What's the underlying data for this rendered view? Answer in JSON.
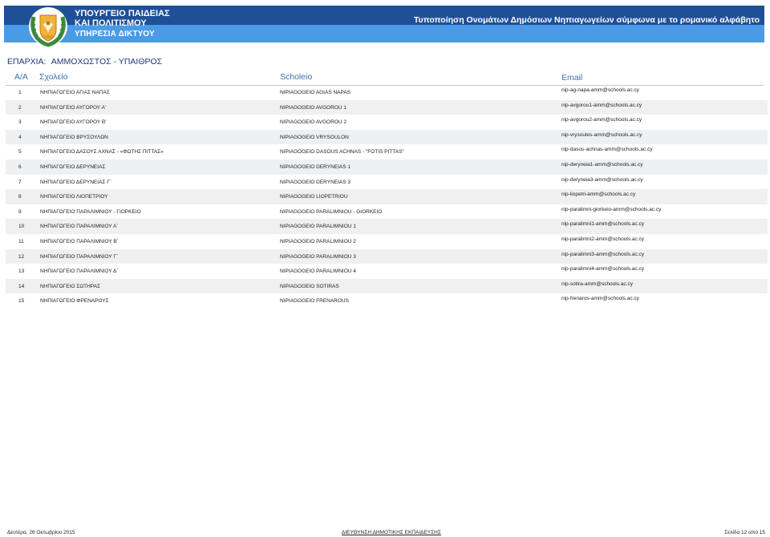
{
  "header": {
    "ministry_line1": "ΥΠΟΥΡΓΕΙΟ ΠΑΙΔΕΙΑΣ",
    "ministry_line2": "ΚΑΙ ΠΟΛΙΤΙΣΜΟΥ",
    "service": "ΥΠΗΡΕΣΙΑ ΔΙΚΤΥΟΥ",
    "tagline": "Τυποποίηση Ονομάτων Δημόσιων Νηπιαγωγείων σύμφωνα με το ρομανικό αλφάβητο",
    "colors": {
      "banner_dark": "#1f4f96",
      "banner_light": "#4b9ae6"
    },
    "logo_icon": "cyprus-coat-of-arms-icon"
  },
  "district": {
    "label": "ΕΠΑΡΧΙΑ:",
    "value": "ΑΜΜΟΧΩΣΤΟΣ - ΥΠΑΙΘΡΟΣ"
  },
  "table": {
    "columns": [
      "Α/Α",
      "Σχολείο",
      "Scholeio",
      "Email"
    ],
    "rows": [
      {
        "num": "1",
        "school": "ΝΗΠΙΑΓΩΓΕΙΟ ΑΓΙΑΣ ΝΑΠΑΣ",
        "scholeio": "NIPIAGOGEIO AGIAS NAPAS",
        "email": "nip-ag-napa-amm@schools.ac.cy"
      },
      {
        "num": "2",
        "school": "ΝΗΠΙΑΓΩΓΕΙΟ ΑΥΓΟΡΟΥ Α'",
        "scholeio": "NIPIAGOGEIO AVGOROU 1",
        "email": "nip-avgorou1-amm@schools.ac.cy"
      },
      {
        "num": "3",
        "school": "ΝΗΠΙΑΓΩΓΕΙΟ ΑΥΓΟΡΟΥ Β'",
        "scholeio": "NIPIAGOGEIO AVGOROU 2",
        "email": "nip-avgorou2-amm@schools.ac.cy"
      },
      {
        "num": "4",
        "school": "ΝΗΠΙΑΓΩΓΕΙΟ ΒΡΥΣΟΥΛΩΝ",
        "scholeio": "NIPIAGOGEIO VRYSOULON",
        "email": "nip-vrysoules-amm@schools.ac.cy"
      },
      {
        "num": "5",
        "school": "ΝΗΠΙΑΓΩΓΕΙΟ ΔΑΣΟΥΣ ΑΧΝΑΣ - «ΦΩΤΗΣ ΠΙΤΤΑΣ»",
        "scholeio": "NIPIAGOGEIO DASOUS ACHNAS - \"FOTIS PITTAS\"",
        "email": "nip-dasos-achnas-amm@schools.ac.cy"
      },
      {
        "num": "6",
        "school": "ΝΗΠΙΑΓΩΓΕΙΟ ΔΕΡΥΝΕΙΑΣ",
        "scholeio": "NIPIAGOGEIO DERYNEIAS 1",
        "email": "nip-deryneia1-amm@schools.ac.cy"
      },
      {
        "num": "7",
        "school": "ΝΗΠΙΑΓΩΓΕΙΟ ΔΕΡΥΝΕΙΑΣ Γ΄",
        "scholeio": "NIPIAGOGEIO DERYNEIAS 3",
        "email": "nip-deryneia3-amm@schools.ac.cy"
      },
      {
        "num": "8",
        "school": "ΝΗΠΙΑΓΩΓΕΙΟ ΛΙΟΠΕΤΡΙΟΥ",
        "scholeio": "NIPIAGOGEIO LIOPETRIOU",
        "email": "nip-liopetri-amm@schools.ac.cy"
      },
      {
        "num": "9",
        "school": "ΝΗΠΙΑΓΩΓΕΙΟ ΠΑΡΑΛΙΜΝΙΟΥ - ΓΙΟΡΚΕΙΟ",
        "scholeio": "NIPIAGOGEIO PARALIMNIOU  - GIORKEIO",
        "email": "nip-paralimni-giorkeio-amm@schools.ac.cy"
      },
      {
        "num": "10",
        "school": "ΝΗΠΙΑΓΩΓΕΙΟ ΠΑΡΑΛΙΜΝΙΟΥ Α΄",
        "scholeio": "NIPIAGOGEIO PARALIMNIOU 1",
        "email": "nip-paralimni1-amm@schools.ac.cy"
      },
      {
        "num": "11",
        "school": "ΝΗΠΙΑΓΩΓΕΙΟ ΠΑΡΑΛΙΜΝΙΟΥ Β΄",
        "scholeio": "NIPIAGOGEIO PARALIMNIOU 2",
        "email": "nip-paralimni2-amm@schools.ac.cy"
      },
      {
        "num": "12",
        "school": "ΝΗΠΙΑΓΩΓΕΙΟ ΠΑΡΑΛΙΜΝΙΟΥ Γ΄",
        "scholeio": "NIPIAGOGEIO PARALIMNIOU 3",
        "email": "nip-paralimni3-amm@schools.ac.cy"
      },
      {
        "num": "13",
        "school": "ΝΗΠΙΑΓΩΓΕΙΟ ΠΑΡΑΛΙΜΝΙΟΥ Δ΄",
        "scholeio": "NIPIAGOGEIO PARALIMNIOU 4",
        "email": "nip-paralimni4-amm@schools.ac.cy"
      },
      {
        "num": "14",
        "school": "ΝΗΠΙΑΓΩΓΕΙΟ ΣΩΤΗΡΑΣ",
        "scholeio": "NIPIAGOGEIO SOTIRAS",
        "email": "nip-sotira-amm@schools.ac.cy"
      },
      {
        "num": "15",
        "school": "ΝΗΠΙΑΓΩΓΕΙΟ ΦΡΕΝΑΡΟΥΣ",
        "scholeio": "NIPIAGOGEIO FRENAROUS",
        "email": "nip-frenaros-amm@schools.ac.cy"
      }
    ]
  },
  "footer": {
    "date": "Δευτέρα, 26 Οκτωβρίου 2015",
    "department": "ΔΙΕΥΘΥΝΣΗ ΔΗΜΟΤΙΚΗΣ ΕΚΠΑΙΔΕΥΣΗΣ",
    "page": "Σελίδα 12 από 15"
  }
}
